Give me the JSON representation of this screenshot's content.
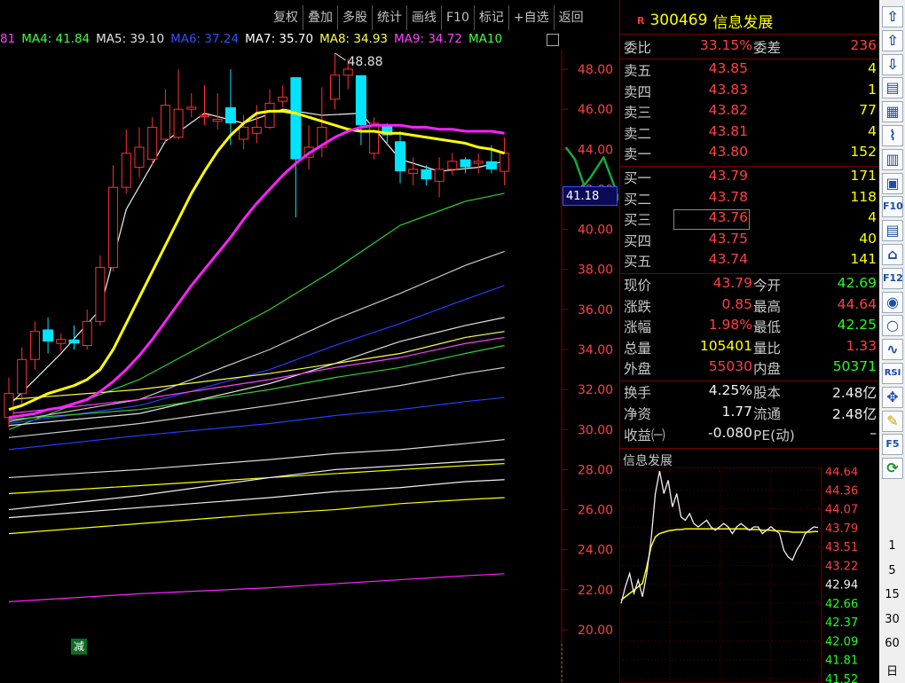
{
  "toolbar": [
    "复权",
    "叠加",
    "多股",
    "统计",
    "画线",
    "F10",
    "标记",
    "+自选",
    "返回"
  ],
  "ma_legend": [
    {
      "text": "81",
      "color": "#ff40ff"
    },
    {
      "text": "MA4: 41.84",
      "color": "#40ff40"
    },
    {
      "text": "MA5: 39.10",
      "color": "#e0e0e0"
    },
    {
      "text": "MA6: 37.24",
      "color": "#3050ff"
    },
    {
      "text": "MA7: 35.70",
      "color": "#ffffff"
    },
    {
      "text": "MA8: 34.93",
      "color": "#ffff40"
    },
    {
      "text": "MA9: 34.72",
      "color": "#ff40ff"
    },
    {
      "text": "MA10",
      "color": "#40ff40"
    }
  ],
  "chart": {
    "y_ticks": [
      "48.00",
      "46.00",
      "44.00",
      "42.00",
      "40.00",
      "38.00",
      "36.00",
      "34.00",
      "32.00",
      "30.00",
      "28.00",
      "26.00",
      "24.00",
      "22.00",
      "20.00"
    ],
    "high_label": "48.88",
    "current_tag": "41.18",
    "reduce_badge": "减"
  },
  "stock": {
    "badge": "R",
    "code": "300469",
    "name": "信息发展"
  },
  "weibi": {
    "label": "委比",
    "value": "33.15%",
    "label2": "委差",
    "value2": "236"
  },
  "sell": [
    {
      "label": "卖五",
      "price": "43.85",
      "vol": "4"
    },
    {
      "label": "卖四",
      "price": "43.83",
      "vol": "1"
    },
    {
      "label": "卖三",
      "price": "43.82",
      "vol": "77"
    },
    {
      "label": "卖二",
      "price": "43.81",
      "vol": "4"
    },
    {
      "label": "卖一",
      "price": "43.80",
      "vol": "152"
    }
  ],
  "buy": [
    {
      "label": "买一",
      "price": "43.79",
      "vol": "171"
    },
    {
      "label": "买二",
      "price": "43.78",
      "vol": "118"
    },
    {
      "label": "买三",
      "price": "43.76",
      "vol": "4"
    },
    {
      "label": "买四",
      "price": "43.75",
      "vol": "40"
    },
    {
      "label": "买五",
      "price": "43.74",
      "vol": "141"
    }
  ],
  "quote": [
    {
      "l1": "现价",
      "v1": "43.79",
      "c1": "red",
      "l2": "今开",
      "v2": "42.69",
      "c2": "green"
    },
    {
      "l1": "涨跌",
      "v1": "0.85",
      "c1": "red",
      "l2": "最高",
      "v2": "44.64",
      "c2": "red"
    },
    {
      "l1": "涨幅",
      "v1": "1.98%",
      "c1": "red",
      "l2": "最低",
      "v2": "42.25",
      "c2": "green"
    },
    {
      "l1": "总量",
      "v1": "105401",
      "c1": "yellow",
      "l2": "量比",
      "v2": "1.33",
      "c2": "red"
    },
    {
      "l1": "外盘",
      "v1": "55030",
      "c1": "red",
      "l2": "内盘",
      "v2": "50371",
      "c2": "green"
    }
  ],
  "fund": [
    {
      "l1": "换手",
      "v1": "4.25%",
      "l2": "股本",
      "v2": "2.48亿"
    },
    {
      "l1": "净资",
      "v1": "1.77",
      "l2": "流通",
      "v2": "2.48亿"
    },
    {
      "l1": "收益㈠",
      "v1": "-0.080",
      "l2": "PE(动)",
      "v2": "–"
    }
  ],
  "mini": {
    "title": "信息发展",
    "y_ticks": [
      {
        "t": "44.64",
        "c": "red"
      },
      {
        "t": "44.36",
        "c": "red"
      },
      {
        "t": "44.07",
        "c": "red"
      },
      {
        "t": "43.79",
        "c": "red"
      },
      {
        "t": "43.51",
        "c": "red"
      },
      {
        "t": "43.22",
        "c": "red"
      },
      {
        "t": "42.94",
        "c": "white"
      },
      {
        "t": "42.66",
        "c": "green"
      },
      {
        "t": "42.37",
        "c": "green"
      },
      {
        "t": "42.09",
        "c": "green"
      },
      {
        "t": "41.81",
        "c": "green"
      },
      {
        "t": "41.52",
        "c": "green"
      }
    ]
  },
  "rtoolbar": {
    "icons": [
      "up-arrow",
      "up-arrow-2",
      "down-arrow",
      "list",
      "table",
      "chart-line",
      "candle",
      "window",
      "f10",
      "doc",
      "home",
      "f12",
      "f10-circle",
      "circle",
      "wave",
      "rsi",
      "move",
      "pencil",
      "f5",
      "refresh"
    ],
    "labels": {
      "rsi": "RSI",
      "f10": "F10",
      "f12": "F12",
      "f5": "F5"
    },
    "periods": [
      "1",
      "5",
      "15",
      "30",
      "60",
      "日"
    ]
  },
  "chart_data": {
    "type": "candlestick",
    "y_range": [
      19.5,
      49.5
    ],
    "candles": [
      {
        "o": 30.6,
        "c": 31.8,
        "h": 32.6,
        "l": 30.1
      },
      {
        "o": 31.8,
        "c": 33.5,
        "h": 34.1,
        "l": 31.2
      },
      {
        "o": 33.5,
        "c": 34.9,
        "h": 35.4,
        "l": 33.0
      },
      {
        "o": 35.0,
        "c": 34.4,
        "h": 35.6,
        "l": 33.8
      },
      {
        "o": 34.3,
        "c": 34.5,
        "h": 34.8,
        "l": 33.9
      },
      {
        "o": 34.5,
        "c": 34.3,
        "h": 35.2,
        "l": 34.0
      },
      {
        "o": 34.2,
        "c": 35.4,
        "h": 36.0,
        "l": 34.0
      },
      {
        "o": 35.4,
        "c": 38.1,
        "h": 38.7,
        "l": 35.2
      },
      {
        "o": 38.1,
        "c": 42.1,
        "h": 43.2,
        "l": 37.9
      },
      {
        "o": 42.1,
        "c": 43.8,
        "h": 45.0,
        "l": 41.8
      },
      {
        "o": 43.1,
        "c": 44.1,
        "h": 45.1,
        "l": 42.6
      },
      {
        "o": 43.5,
        "c": 45.1,
        "h": 45.6,
        "l": 43.2
      },
      {
        "o": 44.5,
        "c": 46.2,
        "h": 47.0,
        "l": 44.3
      },
      {
        "o": 44.6,
        "c": 46.0,
        "h": 48.0,
        "l": 44.5
      },
      {
        "o": 46.0,
        "c": 46.1,
        "h": 46.8,
        "l": 45.6
      },
      {
        "o": 45.7,
        "c": 45.7,
        "h": 47.2,
        "l": 45.2
      },
      {
        "o": 45.4,
        "c": 45.5,
        "h": 46.8,
        "l": 45.0
      },
      {
        "o": 46.1,
        "c": 45.3,
        "h": 48.0,
        "l": 44.2
      },
      {
        "o": 44.5,
        "c": 45.1,
        "h": 45.7,
        "l": 44.0
      },
      {
        "o": 44.8,
        "c": 45.1,
        "h": 46.2,
        "l": 44.3
      },
      {
        "o": 45.1,
        "c": 46.3,
        "h": 47.0,
        "l": 45.0
      },
      {
        "o": 46.4,
        "c": 46.6,
        "h": 47.2,
        "l": 46.1
      },
      {
        "o": 47.6,
        "c": 43.5,
        "h": 47.6,
        "l": 40.6
      },
      {
        "o": 43.6,
        "c": 44.1,
        "h": 45.2,
        "l": 43.0
      },
      {
        "o": 44.1,
        "c": 45.1,
        "h": 47.1,
        "l": 43.6
      },
      {
        "o": 46.5,
        "c": 47.7,
        "h": 48.8,
        "l": 46.0
      },
      {
        "o": 47.7,
        "c": 48.0,
        "h": 48.5,
        "l": 47.0
      },
      {
        "o": 47.7,
        "c": 45.2,
        "h": 47.7,
        "l": 44.2
      },
      {
        "o": 43.8,
        "c": 45.3,
        "h": 45.6,
        "l": 43.5
      },
      {
        "o": 45.2,
        "c": 44.7,
        "h": 45.3,
        "l": 44.2
      },
      {
        "o": 44.4,
        "c": 42.9,
        "h": 44.9,
        "l": 42.3
      },
      {
        "o": 42.8,
        "c": 43.0,
        "h": 43.6,
        "l": 42.2
      },
      {
        "o": 43.0,
        "c": 42.5,
        "h": 43.2,
        "l": 42.2
      },
      {
        "o": 42.4,
        "c": 43.0,
        "h": 43.6,
        "l": 41.6
      },
      {
        "o": 43.0,
        "c": 43.4,
        "h": 43.8,
        "l": 42.7
      },
      {
        "o": 43.5,
        "c": 43.1,
        "h": 43.6,
        "l": 42.8
      },
      {
        "o": 43.3,
        "c": 43.4,
        "h": 43.8,
        "l": 42.8
      },
      {
        "o": 43.4,
        "c": 43.0,
        "h": 44.2,
        "l": 42.8
      },
      {
        "o": 42.9,
        "c": 43.8,
        "h": 44.6,
        "l": 42.2
      }
    ],
    "ma_lines": [
      {
        "name": "MA10",
        "color": "#ffff00",
        "width": 3,
        "values": [
          31.0,
          31.2,
          31.5,
          31.8,
          32.0,
          32.2,
          32.5,
          33.0,
          34.0,
          35.3,
          36.6,
          37.9,
          39.2,
          40.5,
          41.8,
          42.9,
          43.9,
          44.7,
          45.3,
          45.8,
          45.9,
          45.9,
          45.8,
          45.6,
          45.4,
          45.2,
          45.0,
          44.9,
          44.9,
          44.8,
          44.8,
          44.7,
          44.6,
          44.5,
          44.4,
          44.3,
          44.1,
          44.0,
          43.8
        ]
      },
      {
        "name": "MA9",
        "color": "#ff20ff",
        "width": 3,
        "values": [
          30.6,
          30.7,
          30.8,
          31.0,
          31.1,
          31.3,
          31.5,
          31.9,
          32.4,
          33.0,
          33.7,
          34.5,
          35.4,
          36.3,
          37.2,
          38.0,
          38.8,
          39.6,
          40.5,
          41.3,
          42.0,
          42.7,
          43.3,
          43.8,
          44.2,
          44.6,
          44.9,
          45.1,
          45.2,
          45.2,
          45.2,
          45.1,
          45.1,
          45.0,
          45.0,
          44.9,
          44.9,
          44.9,
          44.8
        ]
      }
    ],
    "thin_lines": [
      {
        "color": "#f0f0f0",
        "values": [
          [
            0,
            31.2
          ],
          [
            4,
            33.8
          ],
          [
            7,
            36.0
          ],
          [
            9,
            41.0
          ],
          [
            12,
            44.4
          ],
          [
            15,
            45.8
          ],
          [
            18,
            45.3
          ],
          [
            21,
            46.0
          ],
          [
            24,
            45.7
          ],
          [
            27,
            45.8
          ],
          [
            30,
            43.5
          ],
          [
            33,
            42.9
          ],
          [
            36,
            43.1
          ],
          [
            38,
            43.4
          ]
        ]
      },
      {
        "color": "#30d030",
        "values": [
          [
            0,
            30.0
          ],
          [
            10,
            32.5
          ],
          [
            20,
            36.0
          ],
          [
            25,
            38.0
          ],
          [
            30,
            40.2
          ],
          [
            35,
            41.4
          ],
          [
            38,
            41.8
          ]
        ]
      },
      {
        "color": "#c8c8c8",
        "values": [
          [
            0,
            30.4
          ],
          [
            10,
            31.5
          ],
          [
            20,
            34.0
          ],
          [
            25,
            35.5
          ],
          [
            30,
            36.8
          ],
          [
            35,
            38.2
          ],
          [
            38,
            38.9
          ]
        ]
      },
      {
        "color": "#2040ff",
        "values": [
          [
            0,
            30.3
          ],
          [
            10,
            31.2
          ],
          [
            20,
            33.0
          ],
          [
            25,
            34.2
          ],
          [
            30,
            35.3
          ],
          [
            35,
            36.5
          ],
          [
            38,
            37.2
          ]
        ]
      },
      {
        "color": "#e0e0e0",
        "values": [
          [
            0,
            30.2
          ],
          [
            10,
            30.8
          ],
          [
            20,
            32.3
          ],
          [
            25,
            33.3
          ],
          [
            30,
            34.4
          ],
          [
            35,
            35.2
          ],
          [
            38,
            35.6
          ]
        ]
      },
      {
        "color": "#ffff40",
        "values": [
          [
            0,
            31.5
          ],
          [
            10,
            32.0
          ],
          [
            20,
            32.8
          ],
          [
            25,
            33.3
          ],
          [
            30,
            33.8
          ],
          [
            35,
            34.6
          ],
          [
            38,
            34.9
          ]
        ]
      },
      {
        "color": "#ff40ff",
        "values": [
          [
            0,
            30.8
          ],
          [
            10,
            31.5
          ],
          [
            20,
            32.5
          ],
          [
            25,
            33.1
          ],
          [
            30,
            33.6
          ],
          [
            35,
            34.3
          ],
          [
            38,
            34.6
          ]
        ]
      },
      {
        "color": "#30d030",
        "values": [
          [
            0,
            30.5
          ],
          [
            10,
            31.0
          ],
          [
            20,
            32.0
          ],
          [
            25,
            32.6
          ],
          [
            30,
            33.1
          ],
          [
            35,
            33.8
          ],
          [
            38,
            34.2
          ]
        ]
      },
      {
        "color": "#d0d0d0",
        "values": [
          [
            0,
            29.6
          ],
          [
            10,
            30.3
          ],
          [
            20,
            31.2
          ],
          [
            25,
            31.7
          ],
          [
            30,
            32.2
          ],
          [
            35,
            32.8
          ],
          [
            38,
            33.1
          ]
        ]
      },
      {
        "color": "#2040ff",
        "values": [
          [
            0,
            29.0
          ],
          [
            10,
            29.7
          ],
          [
            20,
            30.3
          ],
          [
            25,
            30.7
          ],
          [
            30,
            31.0
          ],
          [
            35,
            31.4
          ],
          [
            38,
            31.6
          ]
        ]
      },
      {
        "color": "#d8d8d8",
        "values": [
          [
            0,
            27.6
          ],
          [
            10,
            28.0
          ],
          [
            20,
            28.5
          ],
          [
            25,
            28.8
          ],
          [
            30,
            29.0
          ],
          [
            35,
            29.3
          ],
          [
            38,
            29.5
          ]
        ]
      },
      {
        "color": "#ffff00",
        "values": [
          [
            0,
            26.8
          ],
          [
            10,
            27.2
          ],
          [
            20,
            27.6
          ],
          [
            25,
            27.8
          ],
          [
            30,
            28.0
          ],
          [
            35,
            28.2
          ],
          [
            38,
            28.3
          ]
        ]
      },
      {
        "color": "#f0f0f0",
        "values": [
          [
            0,
            26.0
          ],
          [
            10,
            26.7
          ],
          [
            20,
            27.6
          ],
          [
            25,
            28.0
          ],
          [
            30,
            28.2
          ],
          [
            35,
            28.4
          ],
          [
            38,
            28.5
          ]
        ]
      },
      {
        "color": "#f0f0f0",
        "values": [
          [
            0,
            25.6
          ],
          [
            10,
            26.1
          ],
          [
            20,
            26.6
          ],
          [
            25,
            26.9
          ],
          [
            30,
            27.1
          ],
          [
            35,
            27.4
          ],
          [
            38,
            27.5
          ]
        ]
      },
      {
        "color": "#ffff00",
        "values": [
          [
            0,
            24.8
          ],
          [
            10,
            25.3
          ],
          [
            20,
            25.8
          ],
          [
            25,
            26.0
          ],
          [
            30,
            26.3
          ],
          [
            35,
            26.5
          ],
          [
            38,
            26.6
          ]
        ]
      },
      {
        "color": "#ff20ff",
        "values": [
          [
            0,
            21.4
          ],
          [
            10,
            21.8
          ],
          [
            20,
            22.1
          ],
          [
            25,
            22.3
          ],
          [
            30,
            22.5
          ],
          [
            35,
            22.7
          ],
          [
            38,
            22.8
          ]
        ]
      }
    ],
    "projection": [
      [
        42.7,
        44.1
      ],
      [
        43.4,
        43.5
      ],
      [
        44.1,
        42.2
      ],
      [
        44.6,
        42.6
      ],
      [
        45.6,
        43.6
      ],
      [
        46.4,
        42.2
      ],
      [
        47.3,
        40.4
      ],
      [
        47.9,
        39.3
      ],
      [
        48.7,
        40.1
      ],
      [
        49.4,
        39.0
      ],
      [
        50.1,
        38.8
      ],
      [
        50.9,
        38.1
      ],
      [
        51.6,
        37.8
      ],
      [
        52.3,
        38.4
      ],
      [
        53.0,
        39.4
      ],
      [
        53.7,
        37.6
      ],
      [
        54.6,
        36.0
      ]
    ]
  },
  "mini_data": {
    "y_range": [
      41.52,
      44.64
    ],
    "price": [
      42.65,
      42.9,
      43.1,
      42.8,
      43.0,
      42.75,
      43.1,
      43.6,
      44.3,
      44.64,
      44.3,
      44.5,
      44.1,
      44.3,
      43.95,
      43.9,
      44.0,
      43.85,
      43.8,
      43.85,
      43.9,
      43.8,
      43.75,
      43.8,
      43.85,
      43.8,
      43.7,
      43.8,
      43.85,
      43.8,
      43.75,
      43.8,
      43.8,
      43.7,
      43.75,
      43.8,
      43.75,
      43.7,
      43.45,
      43.35,
      43.3,
      43.45,
      43.55,
      43.7,
      43.75,
      43.8,
      43.79
    ],
    "avg": [
      42.7,
      42.75,
      42.8,
      42.85,
      42.9,
      42.95,
      43.2,
      43.5,
      43.65,
      43.7,
      43.72,
      43.74,
      43.75,
      43.76,
      43.76,
      43.77,
      43.77,
      43.77,
      43.77,
      43.77,
      43.77,
      43.77,
      43.77,
      43.77,
      43.77,
      43.77,
      43.77,
      43.77,
      43.77,
      43.77,
      43.76,
      43.76,
      43.76,
      43.75,
      43.75,
      43.75,
      43.74,
      43.74,
      43.73,
      43.73,
      43.72,
      43.72,
      43.72,
      43.72,
      43.72,
      43.73,
      43.73
    ]
  }
}
